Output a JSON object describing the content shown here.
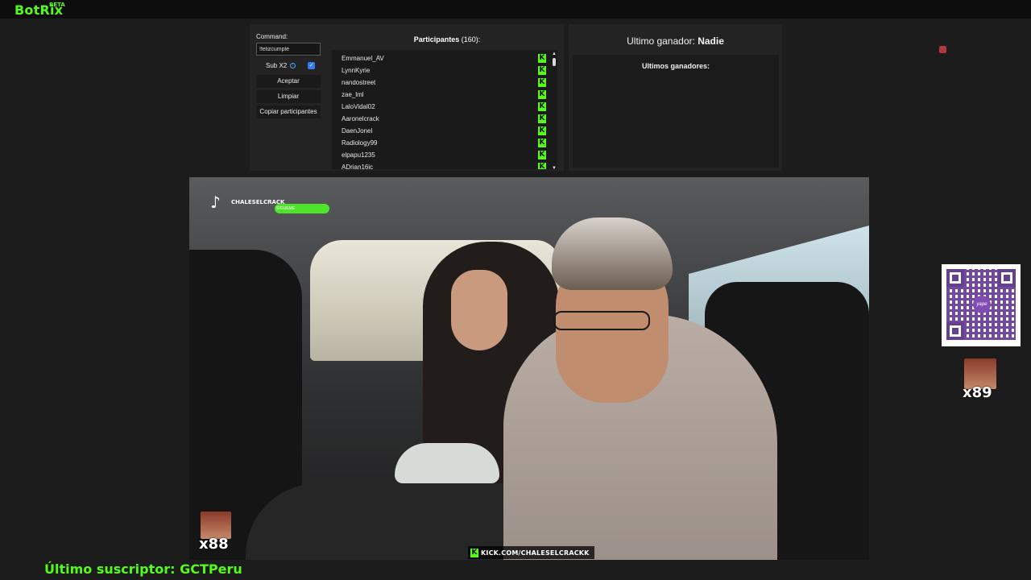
{
  "app": {
    "name": "BotRix",
    "badge": "BETA"
  },
  "command": {
    "label": "Command:",
    "value": "!felizcumple"
  },
  "sub_x2": {
    "label": "Sub X2",
    "checked": true
  },
  "buttons": {
    "accept": "Aceptar",
    "clear": "Limpiar",
    "copy": "Copiar participantes"
  },
  "participants": {
    "title": "Participantes",
    "count": "(160):",
    "items": [
      "Emmanuel_AV",
      "LynnKyrie",
      "nandostreet",
      "zae_lml",
      "LaloVidal02",
      "Aaronelcrack",
      "DaenJonel",
      "Radiology99",
      "elpapu1235",
      "ADrian16ic"
    ]
  },
  "winner": {
    "label": "Ultimo ganador:",
    "name": "Nadie",
    "recent_label": "Ultimos ganadores:"
  },
  "video": {
    "tiktok_handle": "CHALESELCRACK",
    "tiktok_follow": "SIGUEME",
    "kick_url": "KICK.COM/CHALESELCRACKK",
    "counter_left": "x88"
  },
  "sidebar_right": {
    "qr_brand": "yape",
    "counter": "x89"
  },
  "footer": {
    "last_subscriber": "Último suscriptor: GCTPeru"
  },
  "colors": {
    "kick_green": "#53fc18",
    "panel_bg": "#232323",
    "page_bg": "#1c1c1c"
  }
}
